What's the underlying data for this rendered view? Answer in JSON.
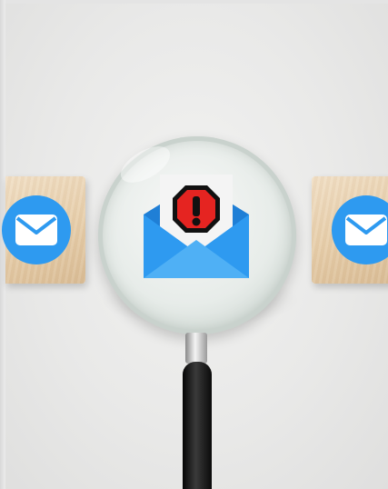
{
  "image": {
    "icons": {
      "left_cube_icon": "envelope-icon",
      "right_cube_icon": "envelope-icon",
      "lens_icon": "envelope-alert-icon",
      "warning_symbol": "exclamation-octagon-icon"
    },
    "colors": {
      "background": "#ebebea",
      "wood_cube": "#e6cda9",
      "envelope_blue": "#2e9af0",
      "envelope_dark_blue": "#1f7fd6",
      "alert_red": "#e52421",
      "handle_black": "#0a0a0a"
    }
  }
}
